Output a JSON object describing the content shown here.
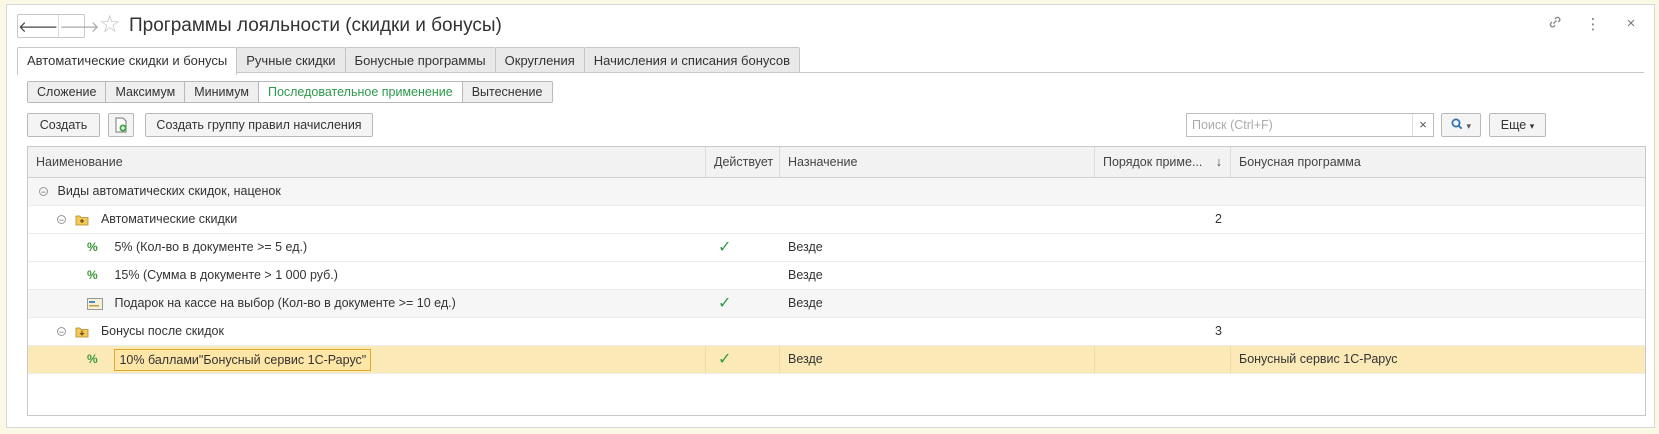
{
  "window": {
    "title": "Программы лояльности (скидки и бонусы)",
    "nav_back": "🡐",
    "nav_forward": "🡒"
  },
  "tabs": [
    {
      "label": "Автоматические скидки и бонусы",
      "active": true
    },
    {
      "label": "Ручные скидки"
    },
    {
      "label": "Бонусные программы"
    },
    {
      "label": "Округления"
    },
    {
      "label": "Начисления и списания бонусов"
    }
  ],
  "modes": [
    {
      "label": "Сложение"
    },
    {
      "label": "Максимум"
    },
    {
      "label": "Минимум"
    },
    {
      "label": "Последовательное применение",
      "active": true
    },
    {
      "label": "Вытеснение"
    }
  ],
  "toolbar": {
    "create_label": "Создать",
    "create_group_label": "Создать группу правил начисления",
    "more_label": "Еще",
    "more_arrow": "▾",
    "search_placeholder": "Поиск (Ctrl+F)",
    "clear_label": "×"
  },
  "table": {
    "columns": [
      "Наименование",
      "Действует",
      "Назначение",
      "Порядок приме...",
      "Бонусная программа"
    ],
    "sort_indicator": "↓",
    "rows": [
      {
        "name": "Виды автоматических скидок, наценок",
        "active": "",
        "purpose": "",
        "order": "",
        "bonus": "",
        "level": 0
      },
      {
        "name": "Автоматические скидки",
        "active": "",
        "purpose": "",
        "order": "2",
        "bonus": "",
        "level": 1
      },
      {
        "name": "5% (Кол-во в документе >= 5 ед.)",
        "active": "✓",
        "purpose": "Везде",
        "order": "",
        "bonus": "",
        "level": 2
      },
      {
        "name": "15% (Сумма в документе > 1 000 руб.)",
        "active": "",
        "purpose": "Везде",
        "order": "",
        "bonus": "",
        "level": 2
      },
      {
        "name": "Подарок на кассе на выбор (Кол-во в документе >= 10 ед.)",
        "active": "✓",
        "purpose": "Везде",
        "order": "",
        "bonus": "",
        "level": 2
      },
      {
        "name": "Бонусы после скидок",
        "active": "",
        "purpose": "",
        "order": "3",
        "bonus": "",
        "level": 1
      },
      {
        "name": "10% баллами\"Бонусный сервис 1С-Рарус\"",
        "active": "✓",
        "purpose": "Везде",
        "order": "",
        "bonus": "Бонусный сервис 1С-Рарус",
        "level": 2
      }
    ]
  },
  "icons": {
    "percent": "%",
    "collapse": "⊖",
    "star": "☆",
    "link": "🔗",
    "kebab": "⋮",
    "close": "×",
    "search": "🔍"
  },
  "colors": {
    "accent_green": "#2b9a4a",
    "selection": "#fbeab8"
  }
}
